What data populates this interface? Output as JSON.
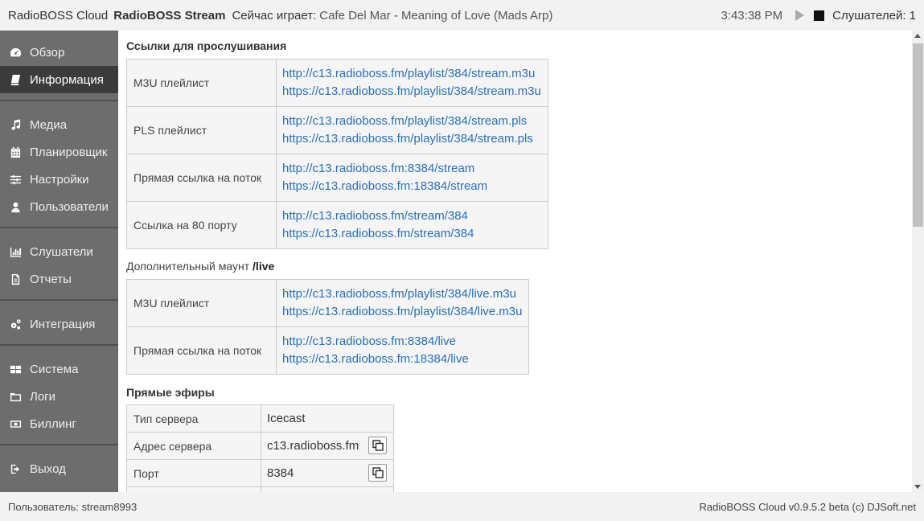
{
  "header": {
    "app_name": "RadioBOSS Cloud",
    "stream_name": "RadioBOSS Stream",
    "now_playing_label": "Сейчас играет:",
    "now_playing_track": "Cafe Del Mar - Meaning of Love (Mads Arp)",
    "clock": "3:43:38 PM",
    "listeners": "Слушателей: 1"
  },
  "sidebar": {
    "items": [
      {
        "label": "Обзор",
        "icon": "dashboard-icon"
      },
      {
        "label": "Информация",
        "icon": "book-icon",
        "active": true
      },
      {
        "label": "Медиа",
        "icon": "music-icon"
      },
      {
        "label": "Планировщик",
        "icon": "calendar-icon"
      },
      {
        "label": "Настройки",
        "icon": "sliders-icon"
      },
      {
        "label": "Пользователи",
        "icon": "user-icon"
      },
      {
        "label": "Слушатели",
        "icon": "bar-chart-icon"
      },
      {
        "label": "Отчеты",
        "icon": "document-icon"
      },
      {
        "label": "Интеграция",
        "icon": "cogs-icon"
      },
      {
        "label": "Система",
        "icon": "grid-icon"
      },
      {
        "label": "Логи",
        "icon": "folder-icon"
      },
      {
        "label": "Биллинг",
        "icon": "money-icon"
      },
      {
        "label": "Выход",
        "icon": "sign-out-icon"
      }
    ]
  },
  "main": {
    "listen_links_title": "Ссылки для прослушивания",
    "listen_links": [
      {
        "label": "M3U плейлист",
        "urls": [
          "http://c13.radioboss.fm/playlist/384/stream.m3u",
          "https://c13.radioboss.fm/playlist/384/stream.m3u"
        ]
      },
      {
        "label": "PLS плейлист",
        "urls": [
          "http://c13.radioboss.fm/playlist/384/stream.pls",
          "https://c13.radioboss.fm/playlist/384/stream.pls"
        ]
      },
      {
        "label": "Прямая ссылка на поток",
        "urls": [
          "http://c13.radioboss.fm:8384/stream",
          "https://c13.radioboss.fm:18384/stream"
        ]
      },
      {
        "label": "Ссылка на 80 порту",
        "urls": [
          "http://c13.radioboss.fm/stream/384",
          "https://c13.radioboss.fm/stream/384"
        ]
      }
    ],
    "extra_mount_label": "Дополнительный маунт",
    "extra_mount_name": "/live",
    "extra_links": [
      {
        "label": "M3U плейлист",
        "urls": [
          "http://c13.radioboss.fm/playlist/384/live.m3u",
          "https://c13.radioboss.fm/playlist/384/live.m3u"
        ]
      },
      {
        "label": "Прямая ссылка на поток",
        "urls": [
          "http://c13.radioboss.fm:8384/live",
          "https://c13.radioboss.fm:18384/live"
        ]
      }
    ],
    "live_title": "Прямые эфиры",
    "server": {
      "type_label": "Тип сервера",
      "type_value": "Icecast",
      "address_label": "Адрес сервера",
      "address_value": "c13.radioboss.fm",
      "port_label": "Порт",
      "port_value": "8384"
    }
  },
  "footer": {
    "user": "Пользователь: stream8993",
    "copyright": "RadioBOSS Cloud v0.9.5.2 beta (c) DJSoft.net"
  }
}
